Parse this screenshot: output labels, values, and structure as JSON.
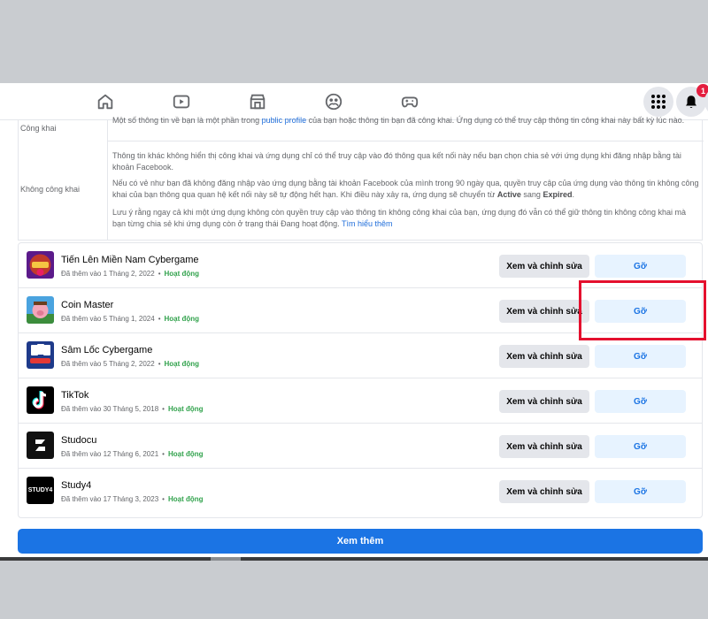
{
  "nav": {
    "icons": [
      "home-icon",
      "video-icon",
      "marketplace-icon",
      "groups-icon",
      "gaming-icon"
    ],
    "menu_icon": "menu-grid-icon",
    "notifications": {
      "icon": "bell-icon",
      "count": "1"
    }
  },
  "visibility": {
    "public": {
      "label": "Công khai",
      "text_pre": "Một số thông tin về bạn là một phần trong ",
      "text_link": "public profile",
      "text_post": " của bạn hoặc thông tin bạn đã công khai. Ứng dụng có thể truy cập thông tin công khai này bất kỳ lúc nào."
    },
    "private": {
      "label": "Không công khai",
      "para1": "Thông tin khác không hiển thị công khai và ứng dụng chỉ có thể truy cập vào đó thông qua kết nối này nếu bạn chọn chia sẻ với ứng dụng khi đăng nhập bằng tài khoản Facebook.",
      "para2_pre": "Nếu có vẻ như bạn đã không đăng nhập vào ứng dụng bằng tài khoản Facebook của mình trong 90 ngày qua, quyền truy cập của ứng dụng vào thông tin không công khai của bạn thông qua quan hệ kết nối này sẽ tự động hết hạn. Khi điều này xảy ra, ứng dụng sẽ chuyển từ ",
      "para2_active": "Active",
      "para2_mid": " sang ",
      "para2_expired": "Expired",
      "para2_end": ".",
      "para3_pre": "Lưu ý rằng ngay cả khi một ứng dụng không còn quyền truy cập vào thông tin không công khai của bạn, ứng dụng đó vẫn có thể giữ thông tin không công khai mà bạn từng chia sẻ khi ứng dụng còn ở trạng thái Đang hoạt động. ",
      "para3_link": "Tìm hiểu thêm"
    }
  },
  "apps": [
    {
      "name": "Tiến Lên Miền Nam Cybergame",
      "added": "Đã thêm vào 1 Tháng 2, 2022",
      "status": "Hoạt động",
      "icon": "tienlen-app-icon"
    },
    {
      "name": "Coin Master",
      "added": "Đã thêm vào 5 Tháng 1, 2024",
      "status": "Hoạt động",
      "icon": "coinmaster-app-icon"
    },
    {
      "name": "Sâm Lốc Cybergame",
      "added": "Đã thêm vào 5 Tháng 2, 2022",
      "status": "Hoạt động",
      "icon": "samloc-app-icon"
    },
    {
      "name": "TikTok",
      "added": "Đã thêm vào 30 Tháng 5, 2018",
      "status": "Hoạt động",
      "icon": "tiktok-app-icon"
    },
    {
      "name": "Studocu",
      "added": "Đã thêm vào 12 Tháng 6, 2021",
      "status": "Hoạt động",
      "icon": "studocu-app-icon"
    },
    {
      "name": "Study4",
      "added": "Đã thêm vào 17 Tháng 3, 2023",
      "status": "Hoạt động",
      "icon": "study4-app-icon",
      "icon_text": "STUDY4"
    }
  ],
  "buttons": {
    "edit_label": "Xem và chỉnh sửa",
    "remove_label": "Gỡ",
    "see_more_label": "Xem thêm"
  },
  "colors": {
    "primary": "#1b74e4",
    "status_green": "#31a24c",
    "highlight_red": "#e4102e"
  }
}
